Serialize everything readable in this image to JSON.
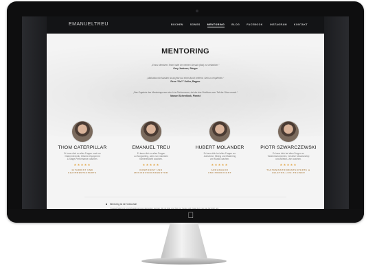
{
  "site": {
    "logo": "EMANUELTREU",
    "nav": {
      "items": [
        "BUCHEN",
        "SONGS",
        "MENTORING",
        "BLOG",
        "FACEBOOK",
        "INSTAGRAM",
        "KONTAKT"
      ],
      "active_index": 2
    }
  },
  "page": {
    "title": "MENTORING",
    "quotes": [
      {
        "text": "„Emos Mentoren-Team habe ich meinen Umsatz (fast) zu verdanken.“",
        "author": "Grey Jackson, Sänger"
      },
      {
        "text": "„Motivation für Musiker ist ab jetzt nur einen Anruf entfernt. Sehr zu empfehlen.“",
        "author": "Rene “Ro?” Koller, Rapper"
      },
      {
        "text": "„Das Ergebnis des Mentorings war eine Live-Performance, bei der das Publikum zum Teil der Show wurde.“",
        "author": "Manuel Schenkbok, Pianist"
      }
    ]
  },
  "team": [
    {
      "name": "THOM CATERPILLAR",
      "desc": [
        "Er kann dich zu allen Fragen rund um",
        "Gitarrentechnik, Gitarren-Equipment",
        "& Stage-Performance coachen."
      ],
      "stars": "★★★★★",
      "tags": [
        "GITARRIST UND",
        "EQUIPMENTEXPERTE"
      ]
    },
    {
      "name": "EMANUEL TREU",
      "desc": [
        "Er kann dich zu allen Fragen",
        "zu Songwriting, oder zum nächsten",
        "Karriereschritt coachen."
      ],
      "stars": "★★★★★",
      "tags": [
        "KOMPONIST UND",
        "MUSIKBUSINESSMENTOR"
      ]
    },
    {
      "name": "HUBERT MOLANDER",
      "desc": [
        "Er kann dich bei allen Fragen zur",
        "Aufnahme, Mixing und Mastering",
        "von Musik coachen."
      ],
      "stars": "★★★★★",
      "tags": [
        "ARRANGEUR",
        "UND PRODUCENT"
      ]
    },
    {
      "name": "PIOTR SZWARCZEWSKI",
      "desc": [
        "Er kann dich bei allen Fragen zu",
        "Tasteninstrumenten, Creative Musicianship",
        "und Ableton-Live coachen."
      ],
      "stars": "★★★★★",
      "tags": [
        "TASTENINSTRUMENTEXPERTE &",
        "ABLETON-LIVE-TRAINER"
      ]
    }
  ],
  "footer_info": {
    "bullet": "Mentoring ist ein Videochat!",
    "detail": "Trusted Mentors und Musikbusiness-Experten stehen dir mit Rat und Tat zur Seite und zwar dort, wo sie für dich am"
  },
  "colors": {
    "nav_bg": "#131416",
    "page_bg": "#f4f4f4",
    "stars": "#e2a84b",
    "tags": "#b48a52"
  },
  "icons": {
    "device_logo": "apple-icon"
  }
}
